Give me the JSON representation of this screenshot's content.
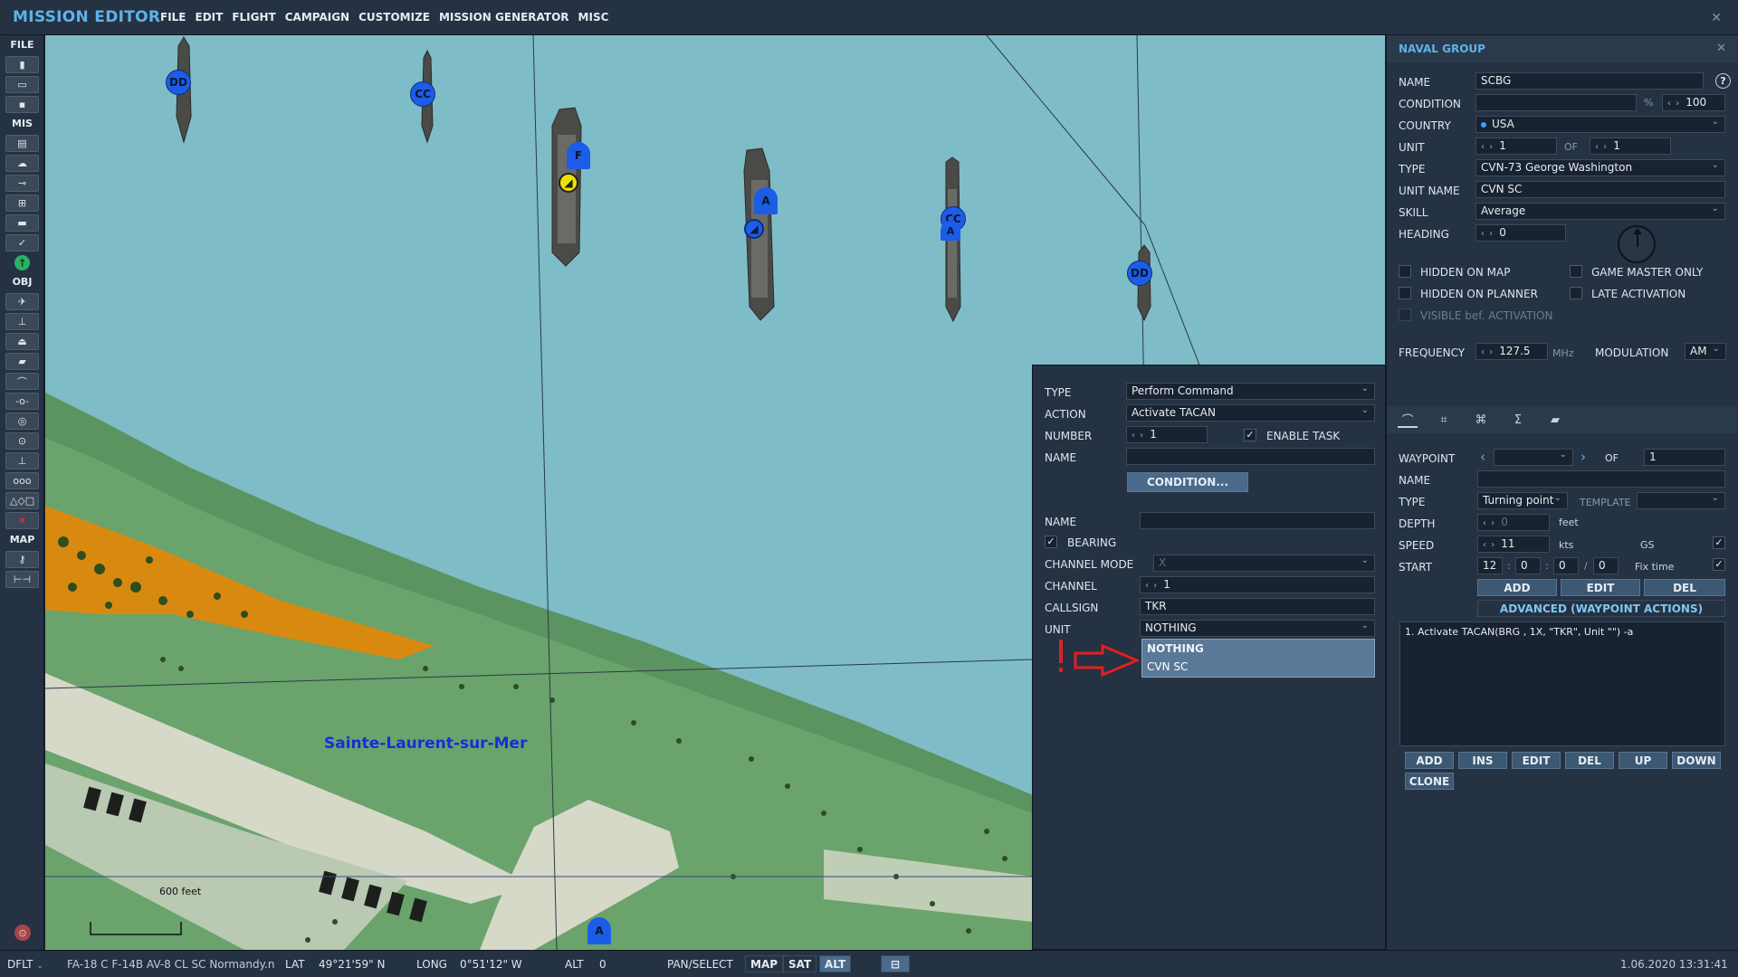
{
  "app": {
    "title": "MISSION EDITOR",
    "menu": [
      "FILE",
      "EDIT",
      "FLIGHT",
      "CAMPAIGN",
      "CUSTOMIZE",
      "MISSION GENERATOR",
      "MISC"
    ]
  },
  "toolbar": {
    "sections": [
      "FILE",
      "MIS",
      "OBJ",
      "MAP"
    ]
  },
  "map": {
    "units": {
      "dd1": "DD",
      "cc1": "CC",
      "f1": "F",
      "a1": "A",
      "cc2": "CC",
      "a2": "A",
      "dd2": "DD",
      "a3": "A"
    },
    "place_label": "Sainte-Laurent-sur-Mer",
    "scale_label": "600 feet"
  },
  "task_panel": {
    "type_label": "TYPE",
    "type_value": "Perform Command",
    "action_label": "ACTION",
    "action_value": "Activate TACAN",
    "number_label": "NUMBER",
    "number_value": "1",
    "enable_task_label": "ENABLE TASK",
    "name_label": "NAME",
    "name_value": "",
    "condition_button": "CONDITION...",
    "name2_label": "NAME",
    "name2_value": "",
    "bearing_label": "BEARING",
    "channel_mode_label": "CHANNEL MODE",
    "channel_mode_value": "X",
    "channel_label": "CHANNEL",
    "channel_value": "1",
    "callsign_label": "CALLSIGN",
    "callsign_value": "TKR",
    "unit_label": "UNIT",
    "unit_value": "NOTHING",
    "unit_options": [
      "NOTHING",
      "CVN SC"
    ]
  },
  "group_panel": {
    "title": "NAVAL GROUP",
    "name_label": "NAME",
    "name_value": "SCBG",
    "condition_label": "CONDITION",
    "condition_value": "",
    "condition_pct": "100",
    "country_label": "COUNTRY",
    "country_value": "USA",
    "unit_label": "UNIT",
    "unit_value": "1",
    "of_label": "OF",
    "unit_of_value": "1",
    "type_label": "TYPE",
    "type_value": "CVN-73 George Washington",
    "unit_name_label": "UNIT NAME",
    "unit_name_value": "CVN SC",
    "skill_label": "SKILL",
    "skill_value": "Average",
    "heading_label": "HEADING",
    "heading_value": "0",
    "hidden_on_map": "HIDDEN ON MAP",
    "game_master_only": "GAME MASTER ONLY",
    "hidden_on_planner": "HIDDEN ON PLANNER",
    "late_activation": "LATE ACTIVATION",
    "visible_bef_activation": "VISIBLE bef. ACTIVATION",
    "frequency_label": "FREQUENCY",
    "frequency_value": "127.5",
    "frequency_unit": "MHz",
    "modulation_label": "MODULATION",
    "modulation_value": "AM",
    "waypoint_label": "WAYPOINT",
    "waypoint_value": "",
    "waypoint_of": "OF",
    "waypoint_total": "1",
    "wp_name_label": "NAME",
    "wp_name_value": "",
    "wp_type_label": "TYPE",
    "wp_type_value": "Turning point",
    "template_label": "TEMPLATE",
    "depth_label": "DEPTH",
    "depth_value": "0",
    "depth_unit": "feet",
    "speed_label": "SPEED",
    "speed_value": "11",
    "speed_unit": "kts",
    "gs_label": "GS",
    "start_label": "START",
    "start_h": "12",
    "start_m": "0",
    "start_s": "0",
    "start_d": "0",
    "fix_time_label": "Fix time",
    "wp_add": "ADD",
    "wp_edit": "EDIT",
    "wp_del": "DEL",
    "advanced_button": "ADVANCED (WAYPOINT ACTIONS)",
    "action_list_item": "1. Activate TACAN(BRG , 1X, \"TKR\", Unit \"\")  -a",
    "list_buttons": [
      "ADD",
      "INS",
      "EDIT",
      "DEL",
      "UP",
      "DOWN"
    ],
    "clone_button": "CLONE"
  },
  "status_bar": {
    "layer": "DFLT",
    "aircraft": "FA-18 C F-14B AV-8 CL SC Normandy.n",
    "lat_label": "LAT",
    "lat_value": "49°21'59\" N",
    "long_label": "LONG",
    "long_value": "0°51'12\" W",
    "alt_label": "ALT",
    "alt_value": "0",
    "pan_select": "PAN/SELECT",
    "map_btn": "MAP",
    "sat_btn": "SAT",
    "alt_btn": "ALT",
    "datetime": "1.06.2020 13:31:41"
  },
  "colors": {
    "accent": "#5fb2e8",
    "sea": "#7ebcc8",
    "land": "#6aa36c",
    "sand": "#d6d8c8",
    "beach": "#d88a10",
    "unit_blue": "#1c5de8",
    "marker_red": "#e02020"
  }
}
